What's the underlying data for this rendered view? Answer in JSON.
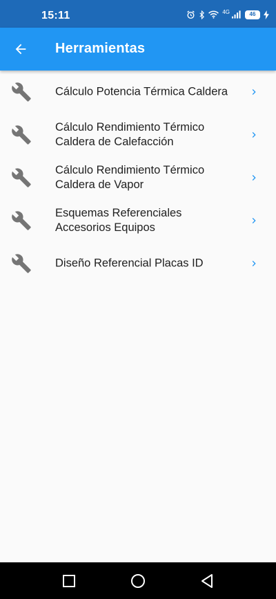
{
  "status_bar": {
    "time": "15:11",
    "network": "4G",
    "battery": "46",
    "icons": [
      "alarm-icon",
      "bluetooth-icon",
      "wifi-icon",
      "signal-icon",
      "battery-icon",
      "charging-icon"
    ]
  },
  "app_bar": {
    "title": "Herramientas",
    "back_icon": "arrow-back-icon"
  },
  "tools": [
    {
      "label": "Cálculo Potencia Térmica Caldera",
      "icon": "wrench-icon"
    },
    {
      "label": "Cálculo Rendimiento Térmico Caldera de Calefacción",
      "icon": "wrench-icon"
    },
    {
      "label": "Cálculo Rendimiento Térmico Caldera de Vapor",
      "icon": "wrench-icon"
    },
    {
      "label": "Esquemas Referenciales Accesorios Equipos",
      "icon": "wrench-icon"
    },
    {
      "label": "Diseño Referencial Placas ID",
      "icon": "wrench-icon"
    }
  ],
  "nav_bar": {
    "icons": [
      "recents-square-icon",
      "home-circle-icon",
      "back-triangle-icon"
    ]
  },
  "colors": {
    "status_bar": "#1e6ab8",
    "app_bar": "#2196f3",
    "background": "#fafafa",
    "icon_gray": "#757575",
    "chevron": "#2196f3"
  }
}
